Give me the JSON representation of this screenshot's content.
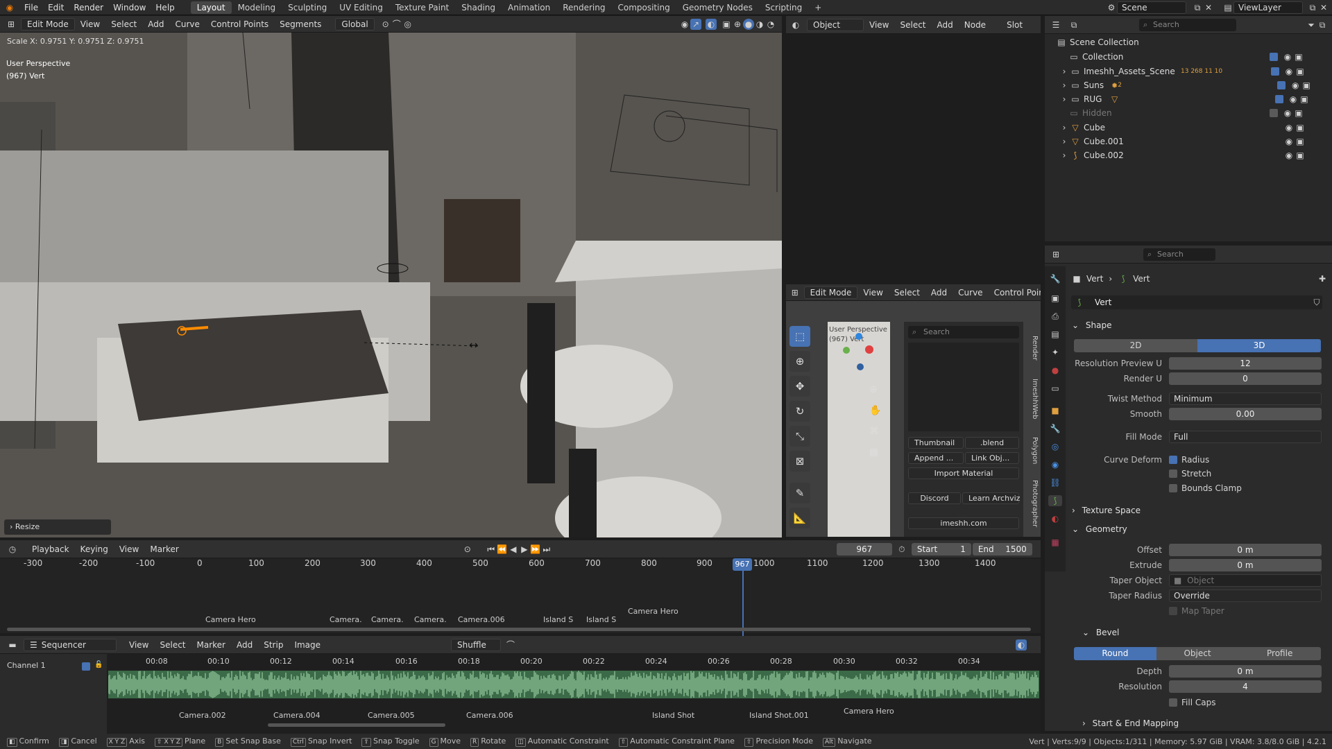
{
  "topbar": {
    "menus": [
      "File",
      "Edit",
      "Render",
      "Window",
      "Help"
    ],
    "workspaces": [
      "Layout",
      "Modeling",
      "Sculpting",
      "UV Editing",
      "Texture Paint",
      "Shading",
      "Animation",
      "Rendering",
      "Compositing",
      "Geometry Nodes",
      "Scripting"
    ],
    "active_workspace": "Layout",
    "add_tab": "+",
    "scene": "Scene",
    "view_layer": "ViewLayer"
  },
  "viewport": {
    "mode": "Edit Mode",
    "menus": [
      "View",
      "Select",
      "Add",
      "Curve",
      "Control Points",
      "Segments"
    ],
    "transform": "Global",
    "header_text": "Scale X: 0.9751  Y: 0.9751  Z: 0.9751",
    "perspective": "User Perspective",
    "subtitle": "(967) Vert",
    "operator_panel": "Resize"
  },
  "node_editor": {
    "object": "Object",
    "menus": [
      "View",
      "Select",
      "Add",
      "Node"
    ],
    "slot": "Slot"
  },
  "mini_viewport": {
    "mode": "Edit Mode",
    "menus": [
      "View",
      "Select",
      "Add",
      "Curve",
      "Control Poir"
    ],
    "overlay_text": "User Perspective",
    "overlay_sub": "(967) Vert",
    "side_tabs": [
      "Render",
      "ImeshhWeb",
      "Polygon",
      "Photographer"
    ]
  },
  "imeshh_panel": {
    "search_placeholder": "Search",
    "thumbnail": "Thumbnail",
    "blend": ".blend",
    "append": "Append ...",
    "link": "Link Obj...",
    "import_material": "Import Material",
    "discord": "Discord",
    "learn": "Learn Archviz",
    "site": "imeshh.com"
  },
  "outliner": {
    "search_placeholder": "Search",
    "root": "Scene Collection",
    "items": [
      {
        "name": "Collection",
        "hidden": false
      },
      {
        "name": "Imeshh_Assets_Scene",
        "hidden": false
      },
      {
        "name": "Suns",
        "hidden": false
      },
      {
        "name": "RUG",
        "hidden": false
      },
      {
        "name": "Hidden",
        "hidden": true
      },
      {
        "name": "Cube",
        "hidden": false
      },
      {
        "name": "Cube.001",
        "hidden": false
      },
      {
        "name": "Cube.002",
        "hidden": false
      }
    ],
    "badges": {
      "suns": "2",
      "imeshh": "13  268  11  10"
    }
  },
  "properties": {
    "search_placeholder": "Search",
    "breadcrumb": [
      "Vert",
      "Vert"
    ],
    "datablock": "Vert",
    "shape_section": "Shape",
    "dim_2d": "2D",
    "dim_3d": "3D",
    "resolution_preview_u": {
      "label": "Resolution Preview U",
      "value": "12"
    },
    "render_u": {
      "label": "Render U",
      "value": "0"
    },
    "twist_method": {
      "label": "Twist Method",
      "value": "Minimum"
    },
    "smooth": {
      "label": "Smooth",
      "value": "0.00"
    },
    "fill_mode": {
      "label": "Fill Mode",
      "value": "Full"
    },
    "curve_deform": {
      "label": "Curve Deform",
      "radius": "Radius",
      "stretch": "Stretch",
      "bounds_clamp": "Bounds Clamp"
    },
    "texture_space": "Texture Space",
    "geometry_section": "Geometry",
    "offset": {
      "label": "Offset",
      "value": "0 m"
    },
    "extrude": {
      "label": "Extrude",
      "value": "0 m"
    },
    "taper_object": {
      "label": "Taper Object",
      "placeholder": "Object"
    },
    "taper_radius": {
      "label": "Taper Radius",
      "value": "Override"
    },
    "map_taper": "Map Taper",
    "bevel_section": "Bevel",
    "bevel_modes": [
      "Round",
      "Object",
      "Profile"
    ],
    "depth": {
      "label": "Depth",
      "value": "0 m"
    },
    "resolution": {
      "label": "Resolution",
      "value": "4"
    },
    "fill_caps": "Fill Caps",
    "start_end": "Start & End Mapping"
  },
  "timeline": {
    "menus": [
      "Playback",
      "Keying",
      "View",
      "Marker"
    ],
    "current_frame": "967",
    "start_label": "Start",
    "start": "1",
    "end_label": "End",
    "end": "1500",
    "ticks": [
      "-300",
      "-200",
      "-100",
      "0",
      "100",
      "200",
      "300",
      "400",
      "500",
      "600",
      "700",
      "800",
      "900",
      "1000",
      "1100",
      "1200",
      "1300",
      "1400"
    ],
    "markers": [
      "Camera Hero",
      "Camera.",
      "Camera.",
      "Camera.",
      "Camera.006",
      "Island S",
      "Island S",
      "Camera Hero"
    ]
  },
  "sequencer": {
    "editor": "Sequencer",
    "menus": [
      "View",
      "Select",
      "Marker",
      "Add",
      "Strip",
      "Image"
    ],
    "shuffle": "Shuffle",
    "channel": "Channel 1",
    "ticks": [
      "00:08",
      "00:10",
      "00:12",
      "00:14",
      "00:16",
      "00:18",
      "00:20",
      "00:22",
      "00:24",
      "00:26",
      "00:28",
      "00:30",
      "00:32",
      "00:34"
    ],
    "markers": [
      "Camera.002",
      "Camera.004",
      "Camera.005",
      "Camera.006",
      "Island Shot",
      "Island Shot.001",
      "Camera Hero"
    ]
  },
  "statusbar": {
    "items": [
      "Confirm",
      "Cancel",
      "Axis",
      "Plane",
      "Set Snap Base",
      "Snap Invert",
      "Snap Toggle",
      "Move",
      "Rotate",
      "Automatic Constraint",
      "Automatic Constraint Plane",
      "Precision Mode",
      "Navigate"
    ],
    "keys": [
      "",
      "",
      "X Y Z",
      "⇧ X Y Z",
      "B",
      "Ctrl",
      "⇧",
      "G",
      "R",
      "",
      "⇧",
      "⇧",
      "Alt"
    ],
    "stats": "Vert | Verts:9/9 | Objects:1/311 | Memory: 5.97 GiB | VRAM: 3.8/8.0 GiB | 4.2.1"
  }
}
